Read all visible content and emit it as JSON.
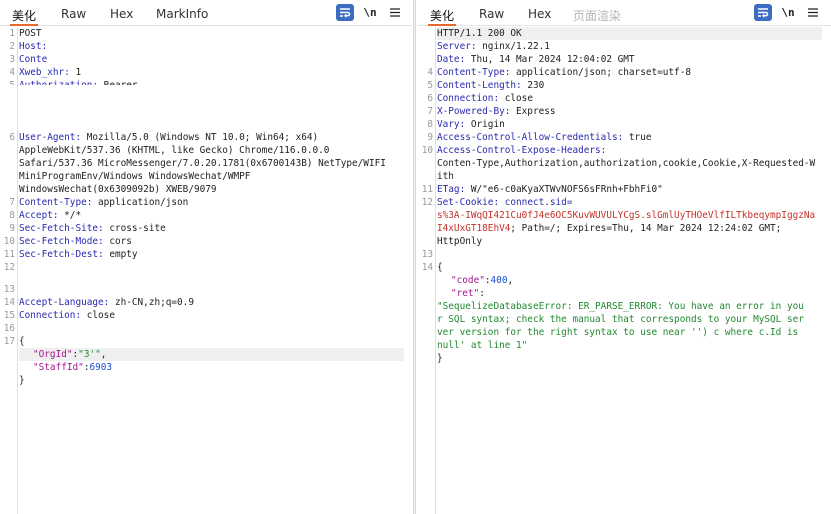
{
  "request": {
    "tabs": [
      "美化",
      "Raw",
      "Hex",
      "MarkInfo"
    ],
    "tools": {
      "wrap": "≡",
      "newline": "\\n",
      "menu": "☰"
    },
    "lines": [
      {
        "n": "1",
        "k": "",
        "v": "POST"
      },
      {
        "n": "2",
        "k": "Host:",
        "v": ""
      },
      {
        "n": "3",
        "k": "Conte",
        "v": "",
        "note": "partially obscured"
      },
      {
        "n": "4",
        "k": "Xweb_xhr:",
        "v": " 1"
      },
      {
        "n": "5",
        "k": "Authorization:",
        "v": " Bearer"
      },
      {
        "n": "6",
        "k": "User-Agent:",
        "v": " Mozilla/5.0 (Windows NT 10.0; Win64; x64)"
      },
      {
        "n": "",
        "k": "",
        "v": "AppleWebKit/537.36 (KHTML, like Gecko) Chrome/116.0.0.0"
      },
      {
        "n": "",
        "k": "",
        "v": "Safari/537.36 MicroMessenger/7.0.20.1781(0x6700143B) NetType/WIFI"
      },
      {
        "n": "",
        "k": "",
        "v": "MiniProgramEnv/Windows WindowsWechat/WMPF"
      },
      {
        "n": "",
        "k": "",
        "v": "WindowsWechat(0x6309092b) XWEB/9079"
      },
      {
        "n": "7",
        "k": "Content-Type:",
        "v": " application/json"
      },
      {
        "n": "8",
        "k": "Accept:",
        "v": " */*"
      },
      {
        "n": "9",
        "k": "Sec-Fetch-Site:",
        "v": " cross-site"
      },
      {
        "n": "10",
        "k": "Sec-Fetch-Mode:",
        "v": " cors"
      },
      {
        "n": "11",
        "k": "Sec-Fetch-Dest:",
        "v": " empty"
      },
      {
        "n": "12",
        "k": "",
        "v": ""
      },
      {
        "n": "13",
        "k": "",
        "v": ""
      },
      {
        "n": "14",
        "k": "Accept-Language:",
        "v": " zh-CN,zh;q=0.9"
      },
      {
        "n": "15",
        "k": "Connection:",
        "v": " close"
      },
      {
        "n": "16",
        "k": "",
        "v": ""
      },
      {
        "n": "17",
        "k": "",
        "v": "{"
      }
    ],
    "body": {
      "orgid_key": "\"OrgId\"",
      "orgid_val": "\"3'\"",
      "staffid_key": "\"StaffId\"",
      "staffid_val": "6903",
      "close": "}"
    }
  },
  "response": {
    "tabs": [
      "美化",
      "Raw",
      "Hex",
      "页面渲染"
    ],
    "tools": {
      "wrap": "≡",
      "newline": "\\n",
      "menu": "☰"
    },
    "status_line": "HTTP/1.1 200 OK",
    "lines": [
      {
        "n": "",
        "k": "Server:",
        "v": " nginx/1.22.1"
      },
      {
        "n": "",
        "k": "Date:",
        "v": " Thu, 14 Mar 2024 12:04:02 GMT"
      },
      {
        "n": "4",
        "k": "Content-Type:",
        "v": " application/json; charset=utf-8"
      },
      {
        "n": "5",
        "k": "Content-Length:",
        "v": " 230"
      },
      {
        "n": "6",
        "k": "Connection:",
        "v": " close"
      },
      {
        "n": "7",
        "k": "X-Powered-By:",
        "v": " Express"
      },
      {
        "n": "8",
        "k": "Vary:",
        "v": " Origin"
      },
      {
        "n": "9",
        "k": "Access-Control-Allow-Credentials:",
        "v": " true"
      },
      {
        "n": "10",
        "k": "Access-Control-Expose-Headers:",
        "v": ""
      },
      {
        "n": "",
        "k": "",
        "v": "Conten-Type,Authorization,authorization,cookie,Cookie,X-Requested-W"
      },
      {
        "n": "",
        "k": "",
        "v": "ith"
      },
      {
        "n": "11",
        "k": "ETag:",
        "v": " W/\"e6-c0aKyaXTWvNOFS6sFRnh+FbhFi0\""
      }
    ],
    "cookie": {
      "n": "12",
      "k": "Set-Cookie:",
      "name": " connect.sid=",
      "value1": "s%3A-IWqQI421Cu0fJ4e6OC5KuvWUVULYCgS.slGmlUyTHOeVlfILTkbeqympIggzNa",
      "value2": "I4xUxGT18EhV4",
      "rest": "; Path=/; Expires=Thu, 14 Mar 2024 12:24:02 GMT;",
      "tail": "HttpOnly"
    },
    "blank_n": "13",
    "json_n": "14",
    "json": {
      "open": "{",
      "code_key": "\"code\"",
      "code_val": "400",
      "ret_key": "\"ret\"",
      "ret_lines": [
        "\"SequelizeDatabaseError: ER_PARSE_ERROR: You have an error in you",
        "r SQL syntax; check the manual that corresponds to your MySQL ser",
        "ver version for the right syntax to use near '') c where c.Id is",
        "null' at line 1\""
      ],
      "close": "}"
    }
  },
  "colors": {
    "accent_underline": "#e8692b",
    "header_key": "#2a2ab0",
    "cookie_value": "#c4312b",
    "json_key": "#a0168c",
    "json_number": "#1d4fd3",
    "json_string": "#1f8a2e",
    "wrap_button": "#3d6dc3"
  }
}
